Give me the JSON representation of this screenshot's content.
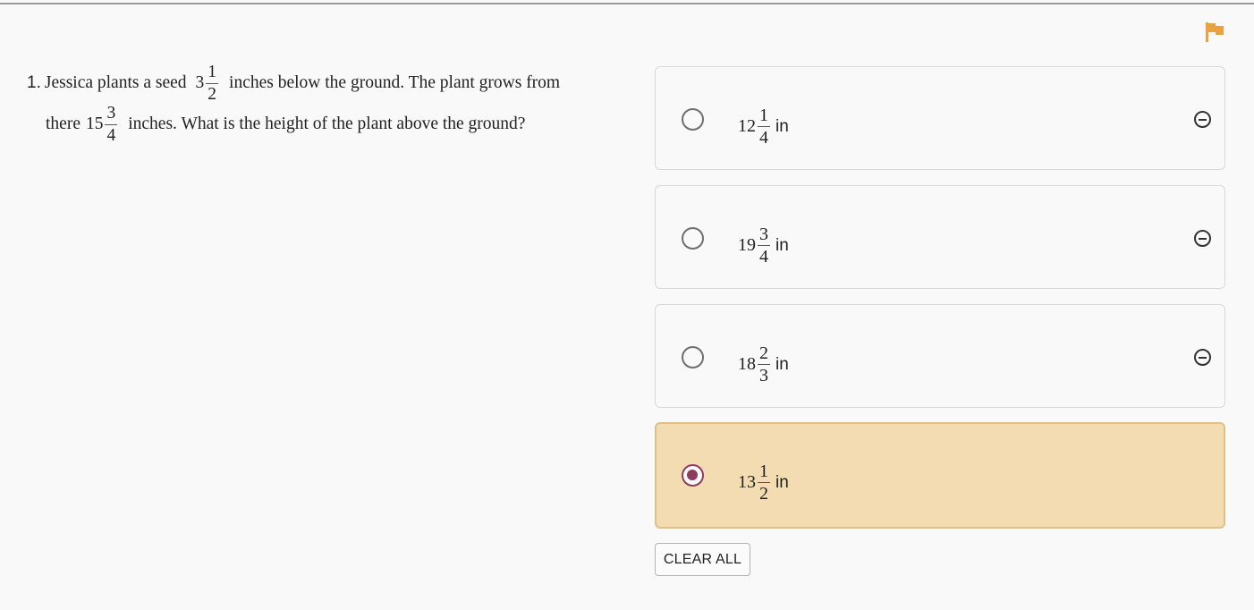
{
  "header": {
    "flag_icon": "flag-icon",
    "flag_color": "#e8a33d"
  },
  "question": {
    "number": "1.",
    "text_1": "Jessica plants a seed",
    "depth": {
      "whole": "3",
      "numerator": "1",
      "denominator": "2"
    },
    "text_2": "inches below the ground.  The plant grows from",
    "text_3": "there",
    "growth": {
      "whole": "15",
      "numerator": "3",
      "denominator": "4"
    },
    "text_4": "inches.  What is the height of the plant above the ground?"
  },
  "choices": [
    {
      "whole": "12",
      "numerator": "1",
      "denominator": "4",
      "unit": "in",
      "selected": false
    },
    {
      "whole": "19",
      "numerator": "3",
      "denominator": "4",
      "unit": "in",
      "selected": false
    },
    {
      "whole": "18",
      "numerator": "2",
      "denominator": "3",
      "unit": "in",
      "selected": false
    },
    {
      "whole": "13",
      "numerator": "1",
      "denominator": "2",
      "unit": "in",
      "selected": true
    }
  ],
  "clear_all_label": "CLEAR ALL",
  "colors": {
    "selected_background": "#f3dcb2",
    "selected_radio": "#8c3d5d"
  }
}
